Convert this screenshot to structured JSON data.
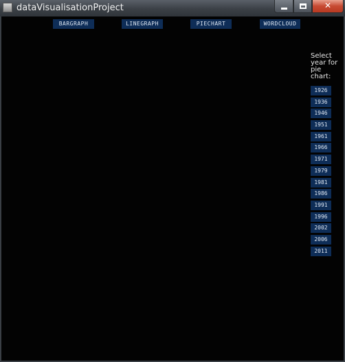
{
  "window": {
    "title": "dataVisualisationProject",
    "controls": {
      "minimize": "",
      "maximize": "",
      "close": "✕"
    }
  },
  "nav": {
    "buttons": [
      "BARGRAPH",
      "LINEGRAPH",
      "PIECHART",
      "WORDCLOUD"
    ]
  },
  "pie_selector": {
    "prompt": "Select year for pie chart:",
    "years": [
      "1926",
      "1936",
      "1946",
      "1951",
      "1961",
      "1966",
      "1971",
      "1979",
      "1981",
      "1986",
      "1991",
      "1996",
      "2002",
      "2006",
      "2011"
    ]
  },
  "colors": {
    "canvas_background": "#030303",
    "button_background": "#0e2d57",
    "button_text": "#dfe8f4",
    "close_button": "#c74a32"
  }
}
